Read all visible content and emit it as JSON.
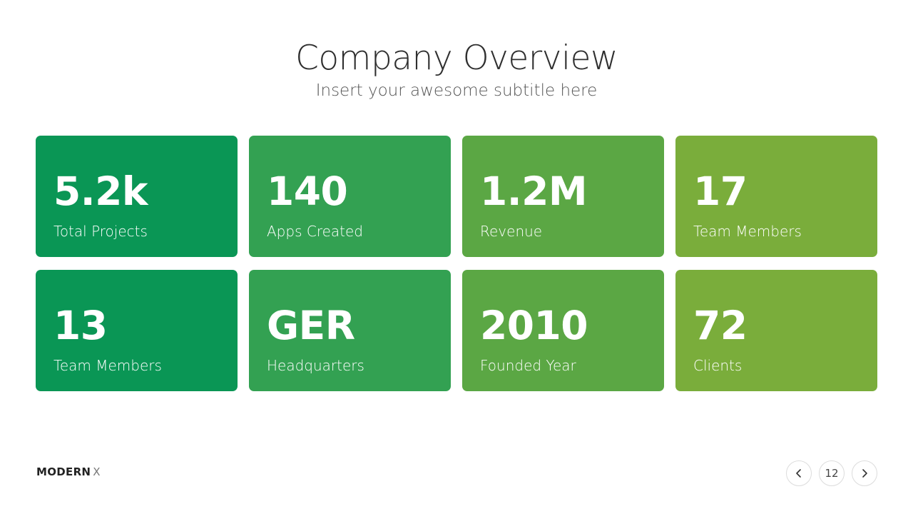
{
  "header": {
    "title": "Company Overview",
    "subtitle": "Insert your awesome subtitle here"
  },
  "colors": {
    "col1": "#0a9655",
    "col2": "#33a152",
    "col3": "#5ba744",
    "col4": "#7aad3b"
  },
  "stats": [
    {
      "value": "5.2k",
      "label": "Total Projects"
    },
    {
      "value": "140",
      "label": "Apps Created"
    },
    {
      "value": "1.2M",
      "label": "Revenue"
    },
    {
      "value": "17",
      "label": "Team Members"
    },
    {
      "value": "13",
      "label": "Team Members"
    },
    {
      "value": "GER",
      "label": "Headquarters"
    },
    {
      "value": "2010",
      "label": "Founded Year"
    },
    {
      "value": "72",
      "label": "Clients"
    }
  ],
  "footer": {
    "brand_bold": "MODERN",
    "brand_light": "X",
    "page_number": "12",
    "prev_icon": "chevron-left-icon",
    "next_icon": "chevron-right-icon"
  }
}
